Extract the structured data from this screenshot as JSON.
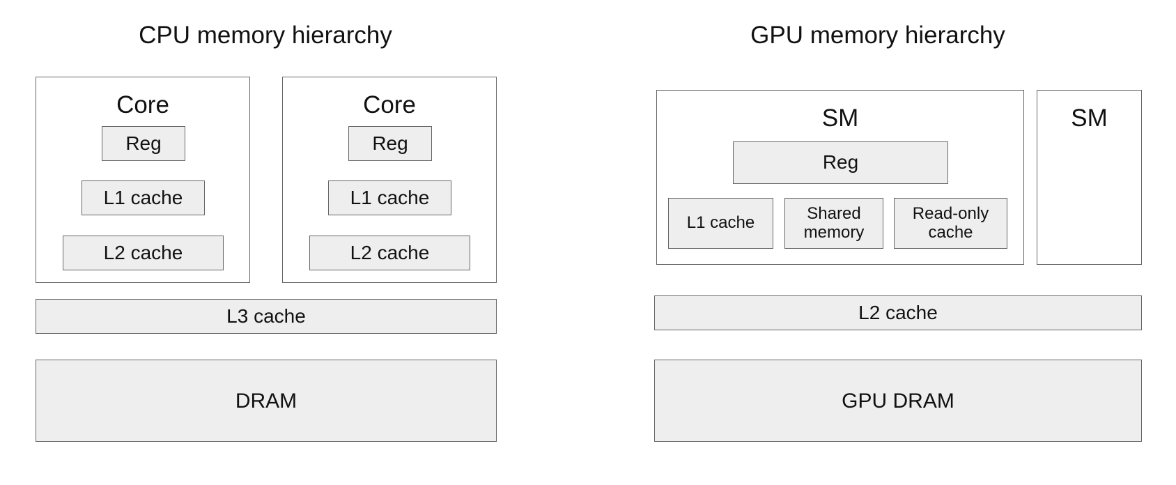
{
  "cpu": {
    "title": "CPU memory hierarchy",
    "cores": [
      {
        "label": "Core",
        "reg": "Reg",
        "l1": "L1 cache",
        "l2": "L2 cache"
      },
      {
        "label": "Core",
        "reg": "Reg",
        "l1": "L1 cache",
        "l2": "L2 cache"
      }
    ],
    "l3": "L3 cache",
    "dram": "DRAM"
  },
  "gpu": {
    "title": "GPU memory hierarchy",
    "sm_main": {
      "label": "SM",
      "reg": "Reg",
      "l1": "L1 cache",
      "shared": "Shared memory",
      "readonly": "Read-only cache"
    },
    "sm_second": {
      "label": "SM"
    },
    "l2": "L2 cache",
    "dram": "GPU DRAM"
  }
}
